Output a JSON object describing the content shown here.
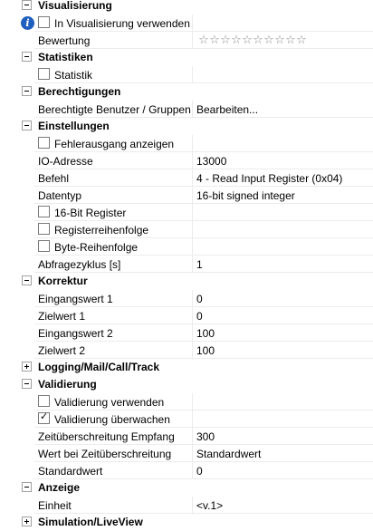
{
  "rows": [
    {
      "kind": "category",
      "title": "Visualisierung",
      "expanded": true
    },
    {
      "kind": "checkbox",
      "label": "In Visualisierung verwenden",
      "checked": false,
      "info_icon": "info-icon",
      "value": ""
    },
    {
      "kind": "rating",
      "label": "Bewertung",
      "rating": 0,
      "max_rating": 10,
      "star_glyph": "☆"
    },
    {
      "kind": "category",
      "title": "Statistiken",
      "expanded": true
    },
    {
      "kind": "checkbox",
      "label": "Statistik",
      "checked": false,
      "value": ""
    },
    {
      "kind": "category",
      "title": "Berechtigungen",
      "expanded": true
    },
    {
      "kind": "property",
      "label": "Berechtigte Benutzer / Gruppen",
      "value": "Bearbeiten..."
    },
    {
      "kind": "category",
      "title": "Einstellungen",
      "expanded": true
    },
    {
      "kind": "checkbox",
      "label": "Fehlerausgang anzeigen",
      "checked": false,
      "value": ""
    },
    {
      "kind": "property",
      "label": "IO-Adresse",
      "value": "13000"
    },
    {
      "kind": "property",
      "label": "Befehl",
      "value": "4 - Read Input Register (0x04)"
    },
    {
      "kind": "property",
      "label": "Datentyp",
      "value": "16-bit signed integer"
    },
    {
      "kind": "checkbox",
      "label": "16-Bit Register",
      "checked": false,
      "value": ""
    },
    {
      "kind": "checkbox",
      "label": "Registerreihenfolge",
      "checked": false,
      "value": ""
    },
    {
      "kind": "checkbox",
      "label": "Byte-Reihenfolge",
      "checked": false,
      "value": ""
    },
    {
      "kind": "property",
      "label": "Abfragezyklus [s]",
      "value": "1"
    },
    {
      "kind": "category",
      "title": "Korrektur",
      "expanded": true
    },
    {
      "kind": "property",
      "label": "Eingangswert 1",
      "value": "0"
    },
    {
      "kind": "property",
      "label": "Zielwert 1",
      "value": "0"
    },
    {
      "kind": "property",
      "label": "Eingangswert 2",
      "value": "100"
    },
    {
      "kind": "property",
      "label": "Zielwert 2",
      "value": "100"
    },
    {
      "kind": "category",
      "title": "Logging/Mail/Call/Track",
      "expanded": false
    },
    {
      "kind": "category",
      "title": "Validierung",
      "expanded": true
    },
    {
      "kind": "checkbox",
      "label": "Validierung verwenden",
      "checked": false,
      "value": ""
    },
    {
      "kind": "checkbox",
      "label": "Validierung überwachen",
      "checked": true,
      "value": ""
    },
    {
      "kind": "property",
      "label": "Zeitüberschreitung Empfang",
      "value": "300"
    },
    {
      "kind": "property",
      "label": "Wert bei Zeitüberschreitung",
      "value": "Standardwert"
    },
    {
      "kind": "property",
      "label": "Standardwert",
      "value": "0"
    },
    {
      "kind": "category",
      "title": "Anzeige",
      "expanded": true
    },
    {
      "kind": "property",
      "label": "Einheit",
      "value": "<v.1>"
    },
    {
      "kind": "category",
      "title": "Simulation/LiveView",
      "expanded": false
    }
  ]
}
